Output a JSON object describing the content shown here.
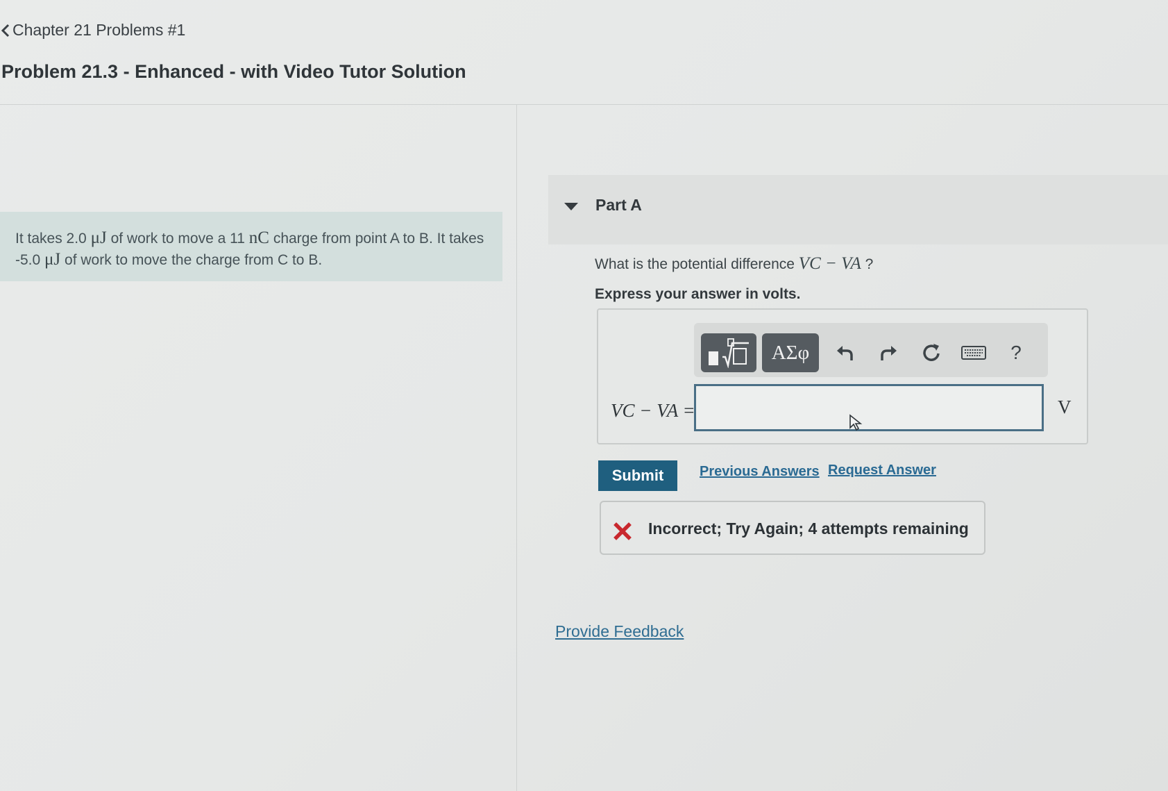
{
  "header": {
    "breadcrumb": "Chapter 21 Problems #1",
    "title": "Problem 21.3 - Enhanced - with Video Tutor Solution"
  },
  "problem": {
    "t1": "It takes 2.0",
    "u1": "μJ",
    "t2": "of work to move a 11",
    "u2": "nC",
    "t3": "charge from point A to B. It takes -5.0",
    "u3": "μJ",
    "t4": "of work to move the charge from C to B."
  },
  "part_a": {
    "title": "Part A",
    "question_prefix": "What is the potential difference",
    "question_expr": "VC − VA",
    "question_suffix": "?",
    "instruction": "Express your answer in volts."
  },
  "answer": {
    "label": "VC − VA =",
    "value": "",
    "placeholder": "",
    "unit": "V"
  },
  "toolbar": {
    "symbols_label": "ΑΣφ",
    "help_label": "?"
  },
  "actions": {
    "submit": "Submit",
    "previous_answers": "Previous Answers",
    "request_answer": "Request Answer"
  },
  "feedback": {
    "status": "incorrect",
    "message": "Incorrect; Try Again; 4 attempts remaining",
    "color": "#c8282e"
  },
  "footer": {
    "provide_feedback": "Provide Feedback"
  },
  "colors": {
    "submit_bg": "#1f5f7f",
    "link": "#2a6a93",
    "problem_bg": "#d3dfdd"
  }
}
